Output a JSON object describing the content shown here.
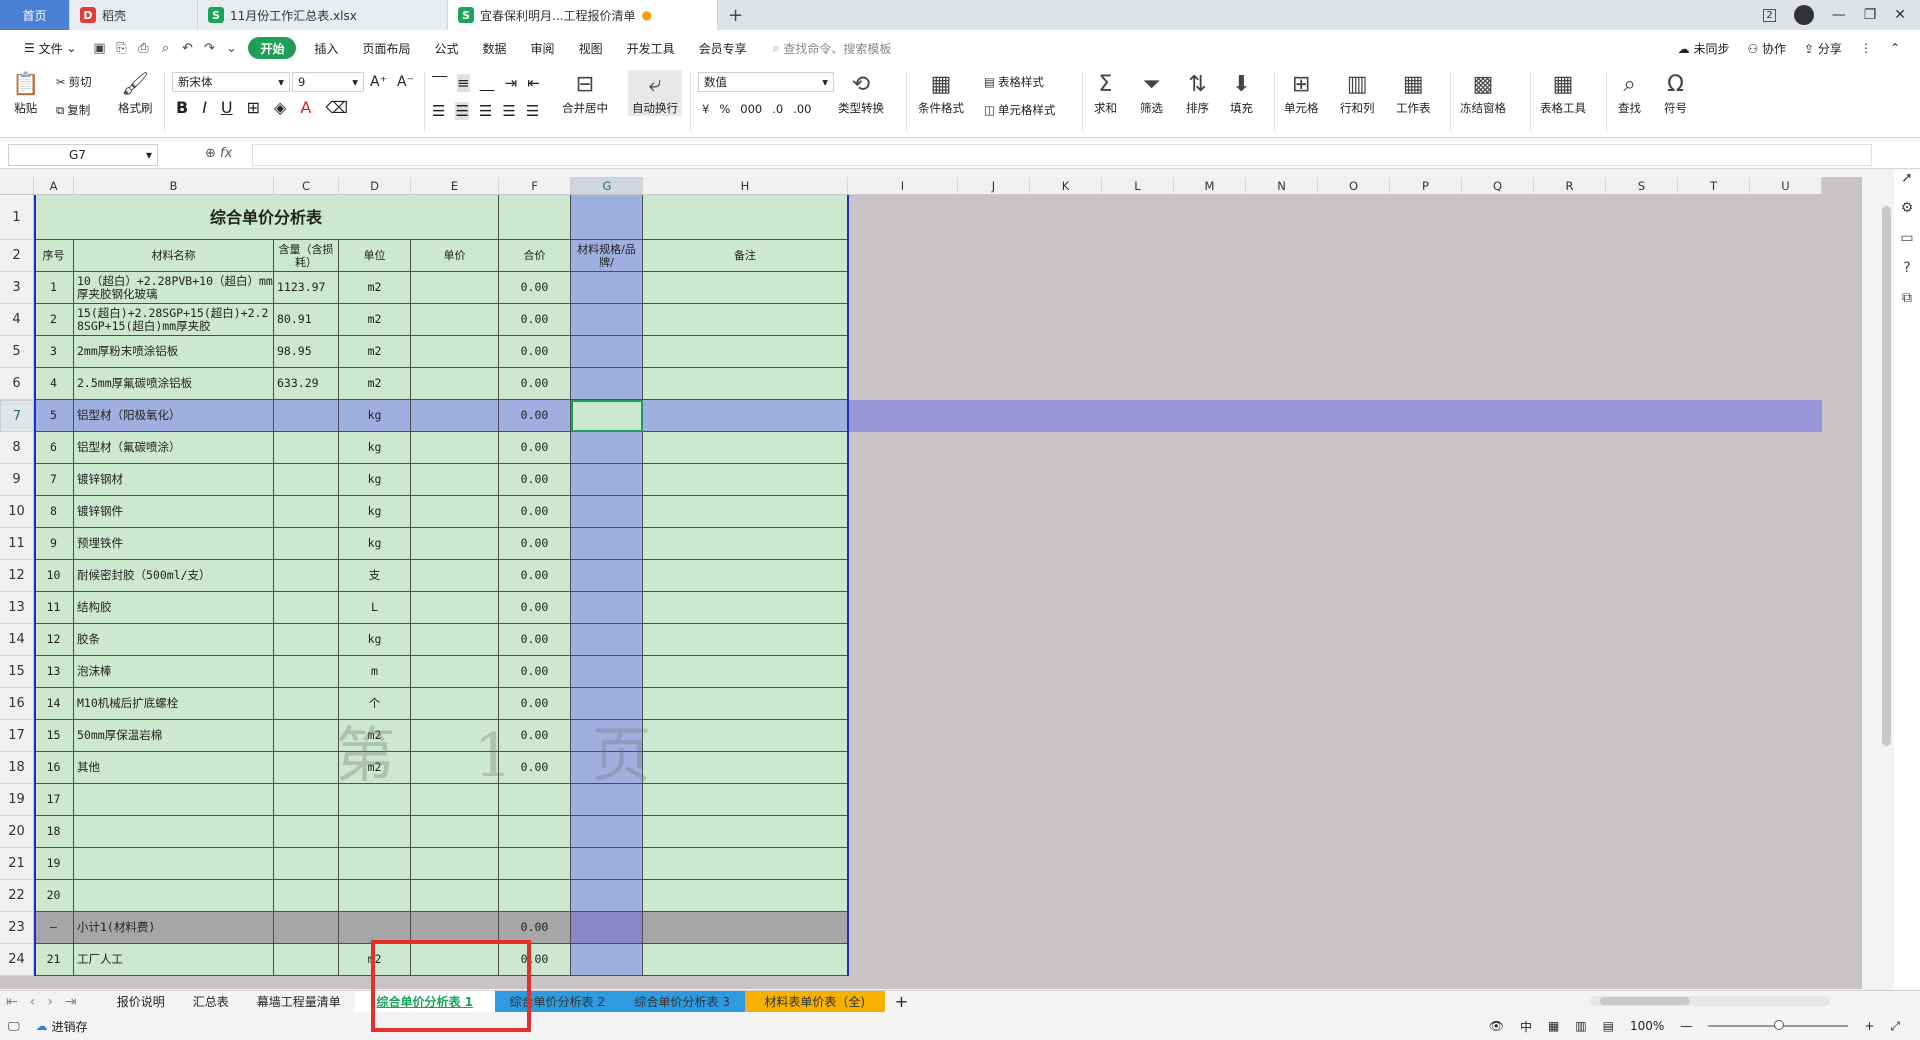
{
  "tabs": [
    {
      "label": "首页"
    },
    {
      "label": "稻壳"
    },
    {
      "label": "11月份工作汇总表.xlsx"
    },
    {
      "label": "宜春保利明月...工程报价清单"
    }
  ],
  "window": {
    "badge": "2"
  },
  "menu": {
    "file": "文件",
    "items": [
      "开始",
      "插入",
      "页面布局",
      "公式",
      "数据",
      "审阅",
      "视图",
      "开发工具",
      "会员专享"
    ],
    "search": "查找命令、搜索模板",
    "sync": "未同步",
    "collab": "协作",
    "share": "分享"
  },
  "ribbon": {
    "paste": "粘贴",
    "cut": "剪切",
    "copy": "复制",
    "format_painter": "格式刷",
    "font": "新宋体",
    "size": "9",
    "merge": "合并居中",
    "wrap": "自动换行",
    "numfmt": "数值",
    "type_convert": "类型转换",
    "cond_fmt": "条件格式",
    "table_style": "表格样式",
    "cell_style": "单元格样式",
    "sum": "求和",
    "filter": "筛选",
    "sort": "排序",
    "fill": "填充",
    "cells": "单元格",
    "rowcol": "行和列",
    "worksheet": "工作表",
    "freeze": "冻结窗格",
    "table_tools": "表格工具",
    "find": "查找",
    "symbol": "符号"
  },
  "namebox": "G7",
  "columns": [
    "A",
    "B",
    "C",
    "D",
    "E",
    "F",
    "G",
    "H",
    "I",
    "J",
    "K",
    "L",
    "M",
    "N",
    "O",
    "P",
    "Q",
    "R",
    "S",
    "T",
    "U"
  ],
  "sheet": {
    "title": "综合单价分析表",
    "headers": [
      "序号",
      "材料名称",
      "含量（含损耗）",
      "单位",
      "单价",
      "合价",
      "材料规格/品牌/",
      "备注"
    ],
    "rows": [
      {
        "r": "3",
        "a": "1",
        "b": "10（超白）+2.28PVB+10（超白）mm厚夹胶钢化玻璃",
        "c": "1123.97",
        "d": "m2",
        "f": "0.00"
      },
      {
        "r": "4",
        "a": "2",
        "b": "15(超白)+2.28SGP+15(超白)+2.28SGP+15(超白)mm厚夹胶",
        "c": "80.91",
        "d": "m2",
        "f": "0.00"
      },
      {
        "r": "5",
        "a": "3",
        "b": "2mm厚粉末喷涂铝板",
        "c": "98.95",
        "d": "m2",
        "f": "0.00"
      },
      {
        "r": "6",
        "a": "4",
        "b": "2.5mm厚氟碳喷涂铝板",
        "c": "633.29",
        "d": "m2",
        "f": "0.00"
      },
      {
        "r": "7",
        "a": "5",
        "b": "铝型材（阳极氧化）",
        "c": "",
        "d": "kg",
        "f": "0.00"
      },
      {
        "r": "8",
        "a": "6",
        "b": "铝型材（氟碳喷涂）",
        "c": "",
        "d": "kg",
        "f": "0.00"
      },
      {
        "r": "9",
        "a": "7",
        "b": "镀锌钢材",
        "c": "",
        "d": "kg",
        "f": "0.00"
      },
      {
        "r": "10",
        "a": "8",
        "b": "镀锌钢件",
        "c": "",
        "d": "kg",
        "f": "0.00"
      },
      {
        "r": "11",
        "a": "9",
        "b": "预埋铁件",
        "c": "",
        "d": "kg",
        "f": "0.00"
      },
      {
        "r": "12",
        "a": "10",
        "b": "耐候密封胶（500ml/支）",
        "c": "",
        "d": "支",
        "f": "0.00"
      },
      {
        "r": "13",
        "a": "11",
        "b": "结构胶",
        "c": "",
        "d": "L",
        "f": "0.00"
      },
      {
        "r": "14",
        "a": "12",
        "b": "胶条",
        "c": "",
        "d": "kg",
        "f": "0.00"
      },
      {
        "r": "15",
        "a": "13",
        "b": "泡沫棒",
        "c": "",
        "d": "m",
        "f": "0.00"
      },
      {
        "r": "16",
        "a": "14",
        "b": "M10机械后扩底螺栓",
        "c": "",
        "d": "个",
        "f": "0.00"
      },
      {
        "r": "17",
        "a": "15",
        "b": "50mm厚保温岩棉",
        "c": "",
        "d": "m2",
        "f": "0.00"
      },
      {
        "r": "18",
        "a": "16",
        "b": "其他",
        "c": "",
        "d": "m2",
        "f": "0.00"
      },
      {
        "r": "19",
        "a": "17",
        "b": "",
        "c": "",
        "d": "",
        "f": ""
      },
      {
        "r": "20",
        "a": "18",
        "b": "",
        "c": "",
        "d": "",
        "f": ""
      },
      {
        "r": "21",
        "a": "19",
        "b": "",
        "c": "",
        "d": "",
        "f": ""
      },
      {
        "r": "22",
        "a": "20",
        "b": "",
        "c": "",
        "d": "",
        "f": ""
      },
      {
        "r": "23",
        "a": "—",
        "b": "小计1(材料费)",
        "c": "",
        "d": "",
        "f": "0.00"
      },
      {
        "r": "24",
        "a": "21",
        "b": "工厂人工",
        "c": "",
        "d": "m2",
        "f": "0.00"
      }
    ],
    "watermark": "第 1 页"
  },
  "sheet_tabs": [
    "报价说明",
    "汇总表",
    "幕墙工程量清单",
    "综合单价分析表 1",
    "综合单价分析表 2",
    "综合单价分析表 3",
    "材料表单价表（全)"
  ],
  "status": {
    "save": "进销存",
    "zoom": "100%"
  }
}
